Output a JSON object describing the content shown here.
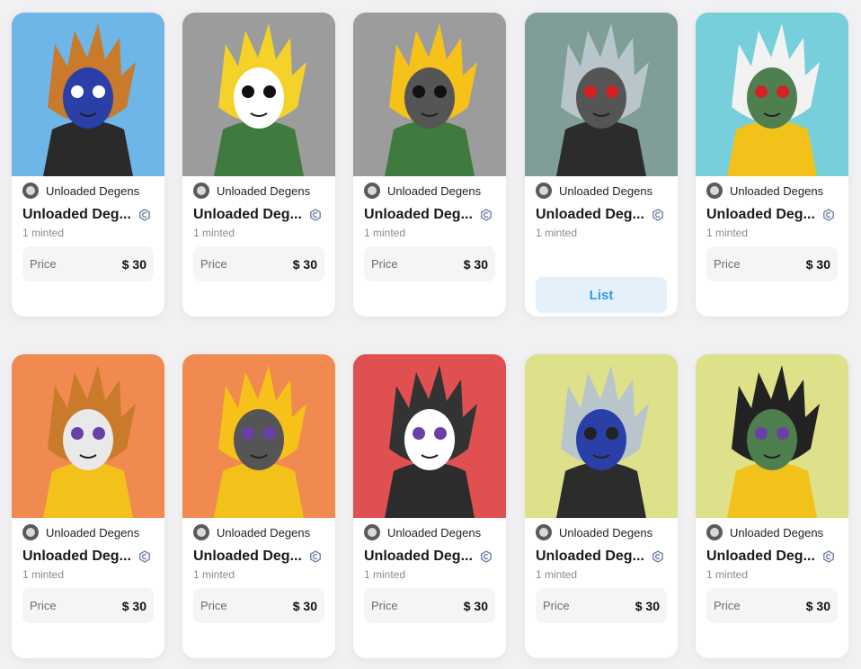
{
  "cards": [
    {
      "creator": "Unloaded Degens",
      "title": "Unloaded Deg...",
      "minted": "1 minted",
      "price_label": "Price",
      "price": "$ 30",
      "bg": "#6eb6e8",
      "fur": "#c97a2a",
      "face": "#2a3fa8",
      "body": "#2a2a2a",
      "eyes": "#ffffff"
    },
    {
      "creator": "Unloaded Degens",
      "title": "Unloaded Deg...",
      "minted": "1 minted",
      "price_label": "Price",
      "price": "$ 30",
      "bg": "#9c9c9c",
      "fur": "#f4d22a",
      "face": "#ffffff",
      "body": "#3f7a3f",
      "eyes": "#111111"
    },
    {
      "creator": "Unloaded Degens",
      "title": "Unloaded Deg...",
      "minted": "1 minted",
      "price_label": "Price",
      "price": "$ 30",
      "bg": "#9c9c9c",
      "fur": "#f6c21a",
      "face": "#555555",
      "body": "#3f7a3f",
      "eyes": "#111111"
    },
    {
      "creator": "Unloaded Degens",
      "title": "Unloaded Deg...",
      "minted": "1 minted",
      "price_label": "",
      "price": "",
      "action": "List",
      "bg": "#7e9e97",
      "fur": "#b8c6cc",
      "face": "#555555",
      "body": "#2c2c2c",
      "eyes": "#d42222"
    },
    {
      "creator": "Unloaded Degens",
      "title": "Unloaded Deg...",
      "minted": "1 minted",
      "price_label": "Price",
      "price": "$ 30",
      "bg": "#76cfdb",
      "fur": "#f2f2f2",
      "face": "#4f7f4f",
      "body": "#f2c21a",
      "eyes": "#d42222"
    },
    {
      "creator": "Unloaded Degens",
      "title": "Unloaded Deg...",
      "minted": "1 minted",
      "price_label": "Price",
      "price": "$ 30",
      "bg": "#f08a50",
      "fur": "#c97a2a",
      "face": "#e9e9e9",
      "body": "#f2c21a",
      "eyes": "#6a3fa8"
    },
    {
      "creator": "Unloaded Degens",
      "title": "Unloaded Deg...",
      "minted": "1 minted",
      "price_label": "Price",
      "price": "$ 30",
      "bg": "#f08a50",
      "fur": "#f6c21a",
      "face": "#555555",
      "body": "#f2c21a",
      "eyes": "#6a3fa8"
    },
    {
      "creator": "Unloaded Degens",
      "title": "Unloaded Deg...",
      "minted": "1 minted",
      "price_label": "Price",
      "price": "$ 30",
      "bg": "#e05050",
      "fur": "#333333",
      "face": "#ffffff",
      "body": "#2c2c2c",
      "eyes": "#6a3fa8"
    },
    {
      "creator": "Unloaded Degens",
      "title": "Unloaded Deg...",
      "minted": "1 minted",
      "price_label": "Price",
      "price": "$ 30",
      "bg": "#dfe08a",
      "fur": "#b8c6cc",
      "face": "#2a3fa8",
      "body": "#2c2c2c",
      "eyes": "#222222"
    },
    {
      "creator": "Unloaded Degens",
      "title": "Unloaded Deg...",
      "minted": "1 minted",
      "price_label": "Price",
      "price": "$ 30",
      "bg": "#dfe08a",
      "fur": "#222222",
      "face": "#4f7f4f",
      "body": "#f2c21a",
      "eyes": "#6a3fa8"
    }
  ]
}
